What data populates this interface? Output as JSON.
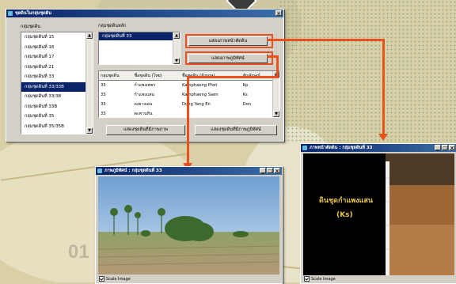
{
  "main_window": {
    "title": "ชุดดินในกลุ่มชุดดิน",
    "close_label": "×",
    "soil_group_label": "กลุ่มชุดดิน",
    "main_group_label": "กลุ่มชุดดินหลัก",
    "soil_groups": [
      "กลุ่มชุดดินที่ 15",
      "กลุ่มชุดดินที่ 16",
      "กลุ่มชุดดินที่ 17",
      "กลุ่มชุดดินที่ 21",
      "กลุ่มชุดดินที่ 33",
      "กลุ่มชุดดินที่ 33/33B",
      "กลุ่มชุดดินที่ 33/38",
      "กลุ่มชุดดินที่ 33B",
      "กลุ่มชุดดินที่ 35",
      "กลุ่มชุดดินที่ 35/35B"
    ],
    "selected_group_index": 5,
    "main_group_value": "กลุ่มชุดดินที่ 33",
    "btn_show_profile": "แสดงภาพหน้าตัดดิน",
    "btn_show_landscape": "แสดงภาพภูมิทัศน์",
    "table_headers": [
      "กลุ่มชุดดิน",
      "ชื่อชุดดิน (ไทย)",
      "ชื่อชุดดิน (อังกฤษ)",
      "สัญลักษณ์"
    ],
    "table_rows": [
      [
        "33",
        "กำแพงเพชร",
        "Kamphaeng Phet",
        "Kp"
      ],
      [
        "33",
        "กำแพงแสน",
        "Kamphaeng Saen",
        "Ks"
      ],
      [
        "33",
        "ดงยางเอน",
        "Dong Yang En",
        "Don"
      ],
      [
        "33",
        "ตะพานหิน",
        "",
        ""
      ]
    ],
    "btn_left_bottom": "แสดงชุดดินที่มีภาพภาพ",
    "btn_right_bottom": "แสดงชุดดินที่มีภาพภูมิทัศน์"
  },
  "landscape_window": {
    "title": "ภาพภูมิทัศน์ : กลุ่มชุดดินที่ 33",
    "status_label": "Scale Image"
  },
  "profile_window": {
    "title": "ภาพหน้าตัดดิน : กลุ่มชุดดินที่ 33",
    "caption_thai": "ดินชุดกำแพงแสน",
    "caption_code": "(Ks)",
    "status_label": "Scale Image"
  },
  "background": {
    "number_text": "01"
  },
  "colors": {
    "accent": "#e8521f",
    "titlebar": "#0a246a"
  }
}
